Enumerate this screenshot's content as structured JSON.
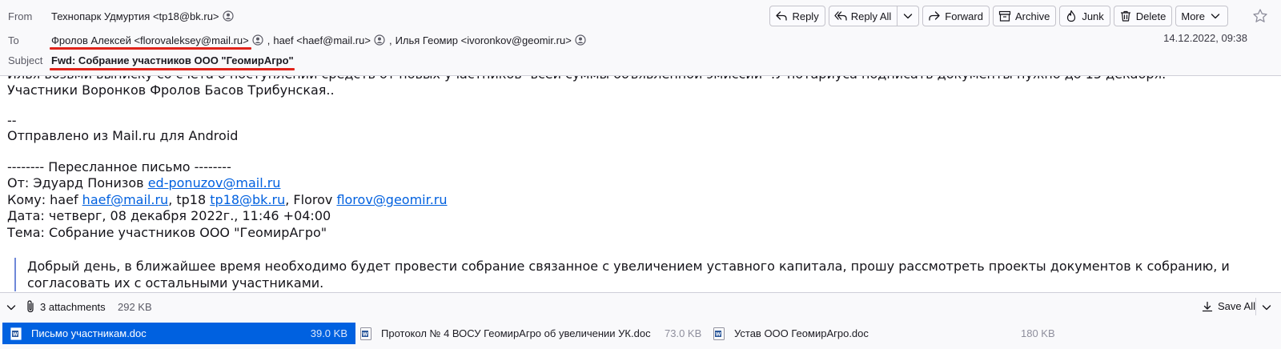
{
  "header": {
    "from_label": "From",
    "from_value": "Технопарк Удмуртия <tp18@bk.ru>",
    "to_label": "To",
    "recipients": [
      "Фролов Алексей <florovaleksey@mail.ru>",
      "haef <haef@mail.ru>",
      "Илья Геомир <ivoronkov@geomir.ru>"
    ],
    "recipient_separator": ",",
    "subject_label": "Subject",
    "subject": "Fwd: Собрание участников ООО \"ГеомирАгро\"",
    "date": "14.12.2022, 09:38",
    "annotation_color": "#e0241b",
    "toolbar": {
      "reply": "Reply",
      "reply_all": "Reply All",
      "forward": "Forward",
      "archive": "Archive",
      "junk": "Junk",
      "delete": "Delete",
      "more": "More"
    }
  },
  "message": {
    "cut_line": "Илья возьми выписку со счета о поступлении средств от новых участников -всей суммы объявленной эмиссии -.У нотариуса подписать документы нужно до 15 декабря.",
    "participants": "Участники Воронков Фролов Басов Трибунская..",
    "sig_dash": "--",
    "sent_from": "Отправлено из Mail.ru для Android",
    "forward_header": "-------- Пересланное письмо --------",
    "from_prefix": "От: Эдуард Понизов ",
    "from_link": "ed-ponuzov@mail.ru",
    "to_prefix": "Кому: haef ",
    "to_link1": "haef@mail.ru",
    "to_mid1": ", tp18 ",
    "to_link2": "tp18@bk.ru",
    "to_mid2": ", Florov ",
    "to_link3": "florov@geomir.ru",
    "date_line": "Дата: четверг, 08 декабря 2022г., 11:46 +04:00",
    "subject_line": "Тема: Собрание участников ООО \"ГеомирАгро\"",
    "quote_text": "Добрый день, в ближайшее время необходимо будет провести собрание связанное с увеличением уставного капитала, прошу рассмотреть проекты документов к собранию, и согласовать их с остальными участниками."
  },
  "attachments": {
    "count_label": "3 attachments",
    "total_size": "292 KB",
    "save_all": "Save All",
    "items": [
      {
        "name": "Письмо участникам.doc",
        "size": "39.0 KB"
      },
      {
        "name": "Протокол № 4 ВОСУ ГеомирАгро об увеличении УК.doc",
        "size": "73.0 KB"
      },
      {
        "name": "Устав ООО ГеомирАгро.doc",
        "size": "180 KB"
      }
    ]
  }
}
